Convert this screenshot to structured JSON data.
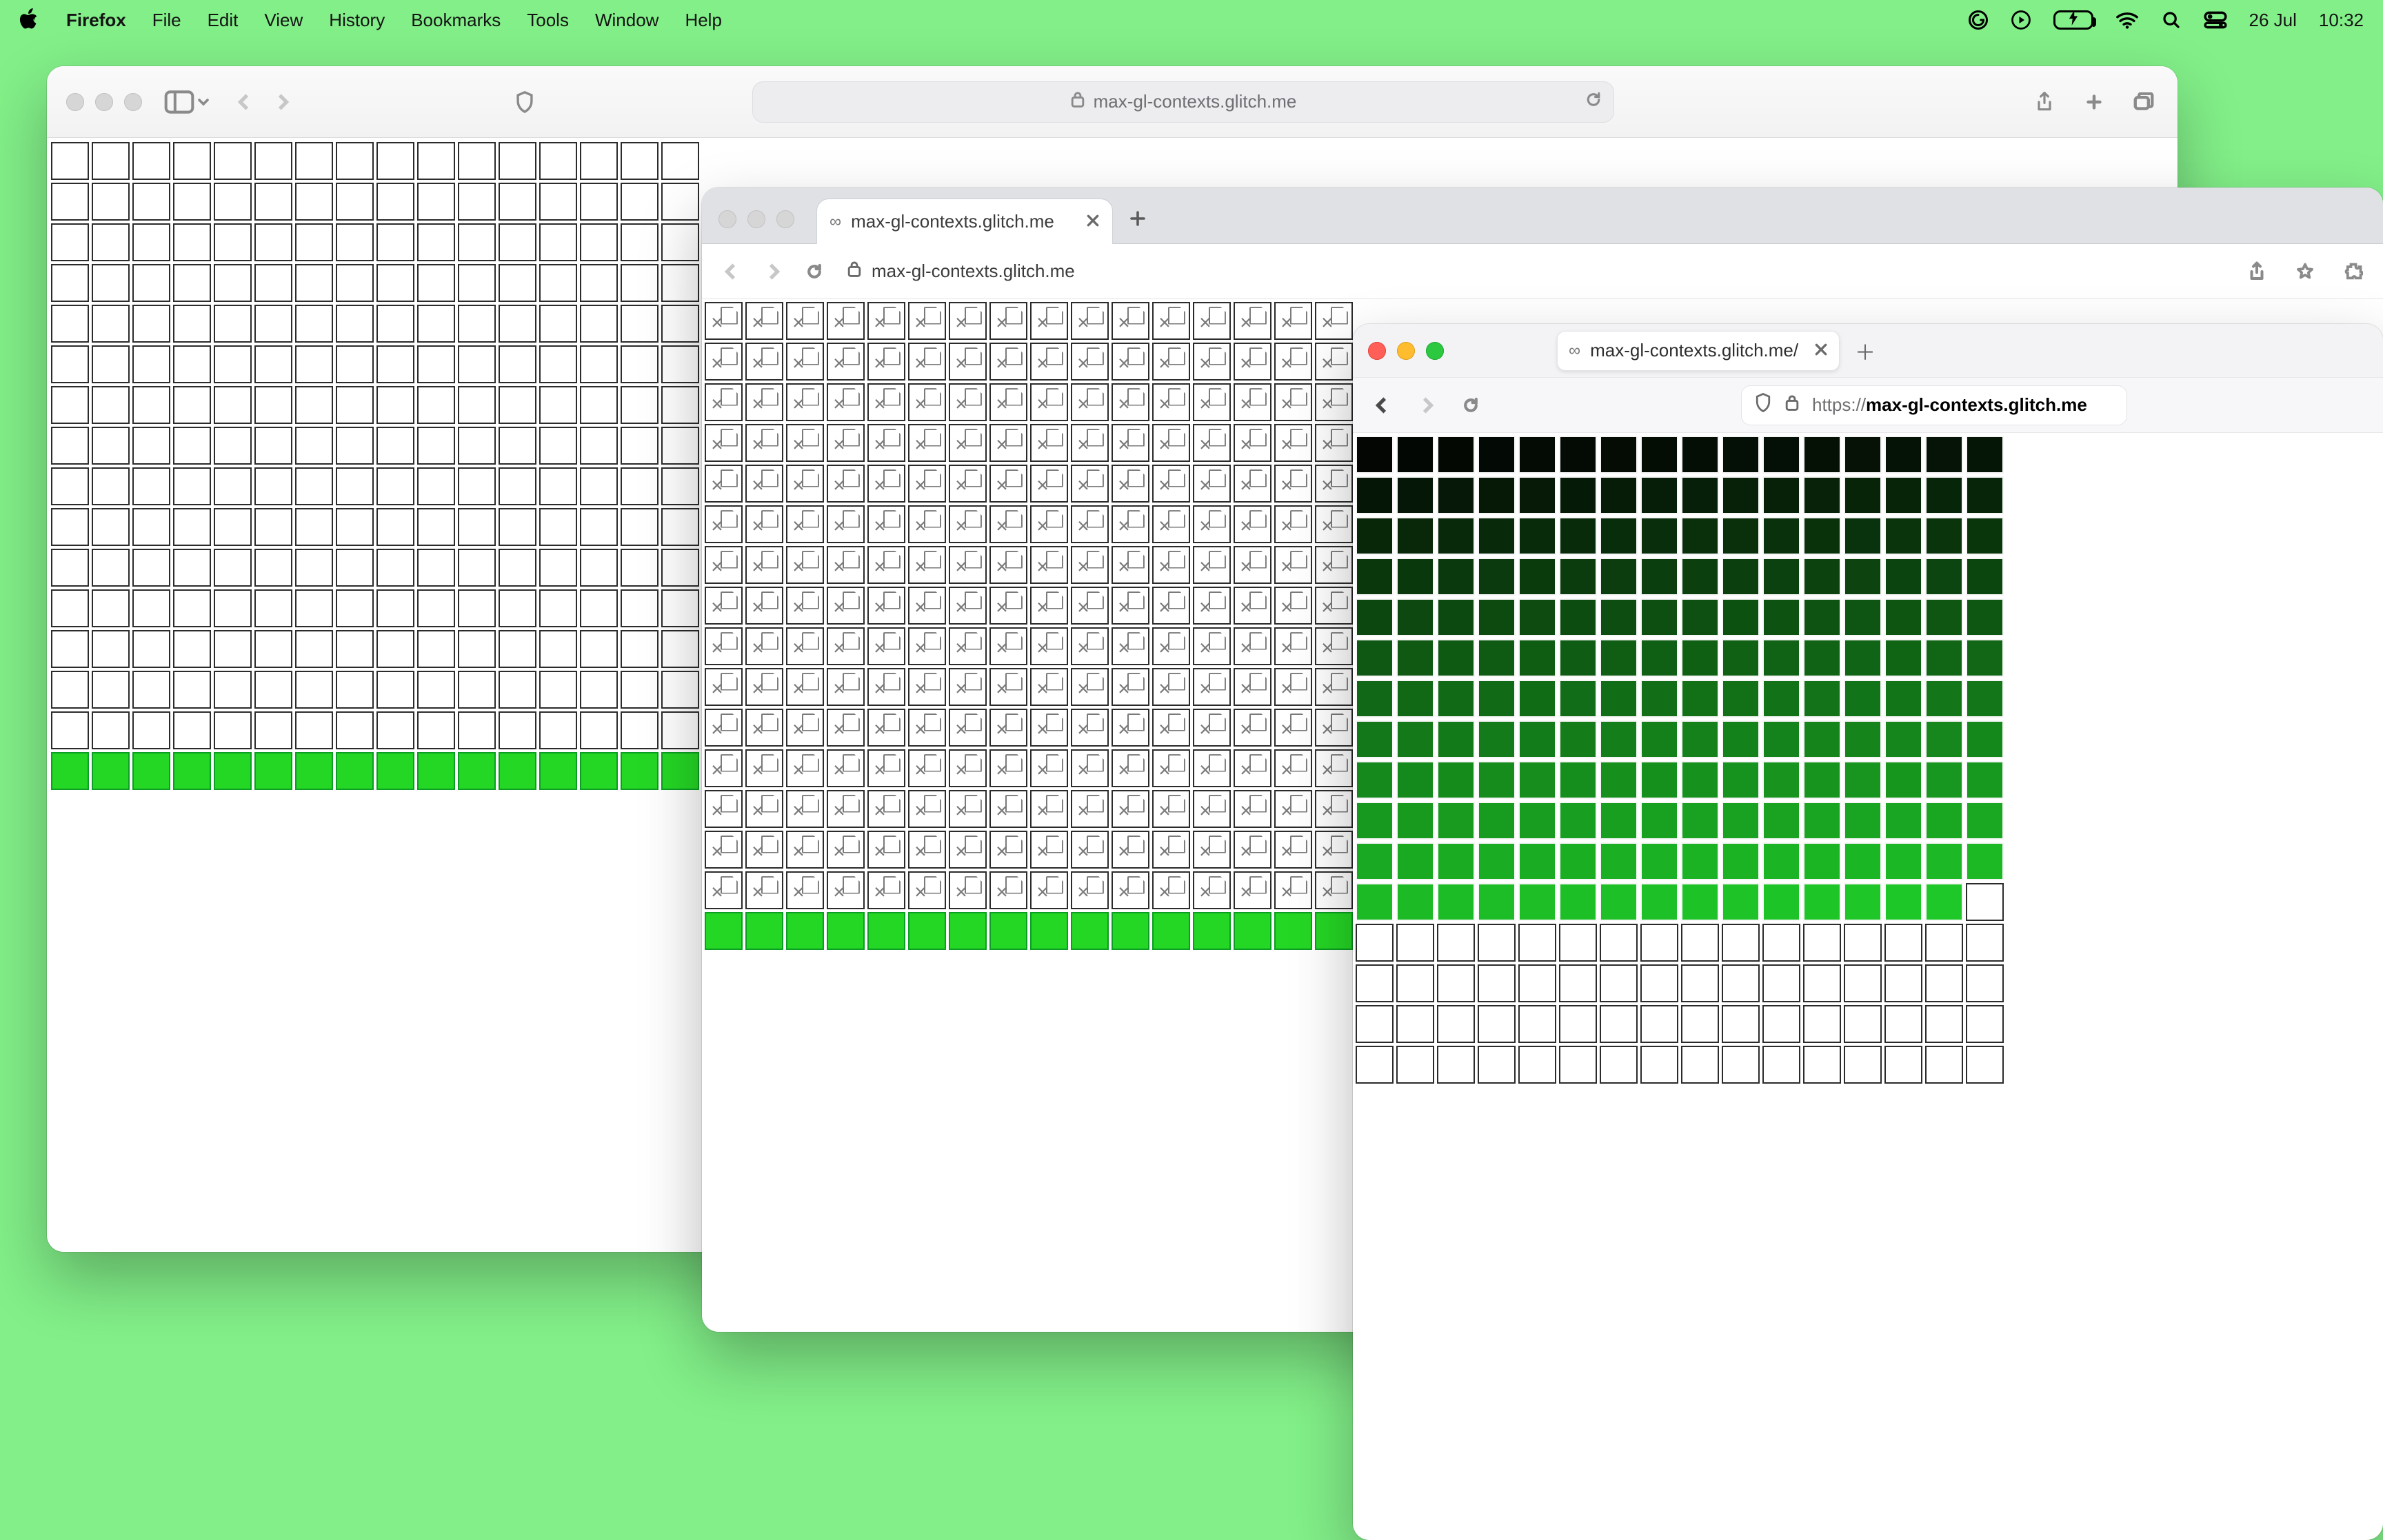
{
  "menubar": {
    "app": "Firefox",
    "items": [
      "File",
      "Edit",
      "View",
      "History",
      "Bookmarks",
      "Tools",
      "Window",
      "Help"
    ],
    "date": "26 Jul",
    "time": "10:32"
  },
  "safari": {
    "url_display": "max-gl-contexts.glitch.me",
    "grid": {
      "cols": 16,
      "rows": 16,
      "cell": 55,
      "filled_green_rows_from_bottom": 1
    }
  },
  "chrome": {
    "tab_title": "max-gl-contexts.glitch.me",
    "url_display": "max-gl-contexts.glitch.me",
    "grid": {
      "cols": 16,
      "rows": 16,
      "cell": 55,
      "broken_rows": 15,
      "filled_green_rows_from_bottom": 1
    }
  },
  "firefox": {
    "tab_title": "max-gl-contexts.glitch.me/",
    "url_display": "max-gl-contexts.glitch.me",
    "url_prefix": "https://",
    "grid": {
      "cols": 16,
      "rows": 16,
      "cell": 55,
      "gradient_filled_count": 191
    }
  },
  "colors": {
    "desktop": "#82ef88",
    "green_solid": "#25d725"
  }
}
